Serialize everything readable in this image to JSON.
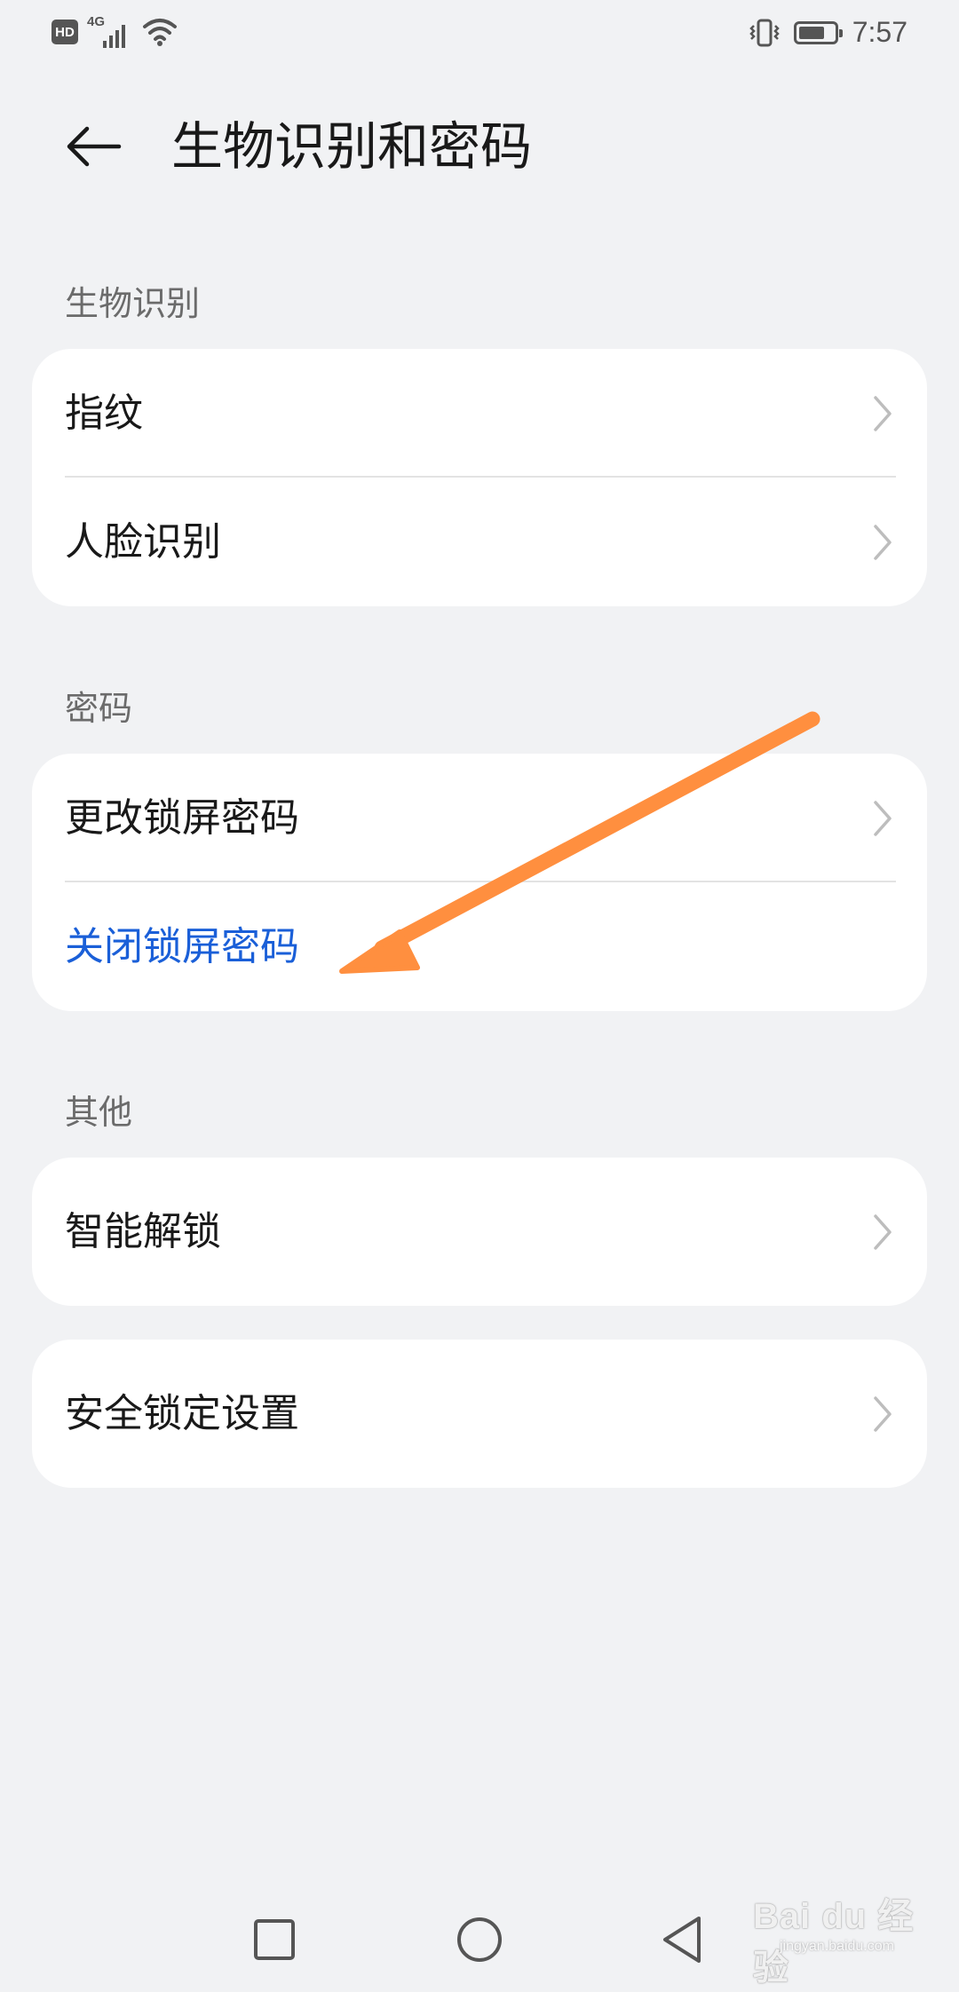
{
  "status_bar": {
    "hd_badge": "HD",
    "network_type": "4G",
    "time": "7:57",
    "battery_level": 0.75,
    "icons": [
      "hd-icon",
      "signal-icon",
      "wifi-icon",
      "vibrate-icon",
      "battery-icon"
    ]
  },
  "header": {
    "back_icon": "arrow-left-icon",
    "title": "生物识别和密码"
  },
  "sections": {
    "biometrics": {
      "label": "生物识别",
      "items": [
        {
          "label": "指纹"
        },
        {
          "label": "人脸识别"
        }
      ]
    },
    "password": {
      "label": "密码",
      "items": [
        {
          "label": "更改锁屏密码"
        },
        {
          "label": "关闭锁屏密码"
        }
      ]
    },
    "other": {
      "label": "其他",
      "items": [
        {
          "label": "智能解锁"
        }
      ]
    },
    "security": {
      "items": [
        {
          "label": "安全锁定设置"
        }
      ]
    }
  },
  "annotation": {
    "color": "#ff8f3f"
  },
  "nav_bar": {
    "icons": [
      "recent-apps-icon",
      "home-icon",
      "back-icon"
    ]
  },
  "watermark": {
    "text": "Bai du 经验",
    "subtext": "jingyan.baidu.com"
  },
  "colors": {
    "background": "#f1f2f4",
    "card": "#ffffff",
    "accent": "#1a5fd8",
    "text": "#191919",
    "section_label": "#6b6b6b"
  }
}
